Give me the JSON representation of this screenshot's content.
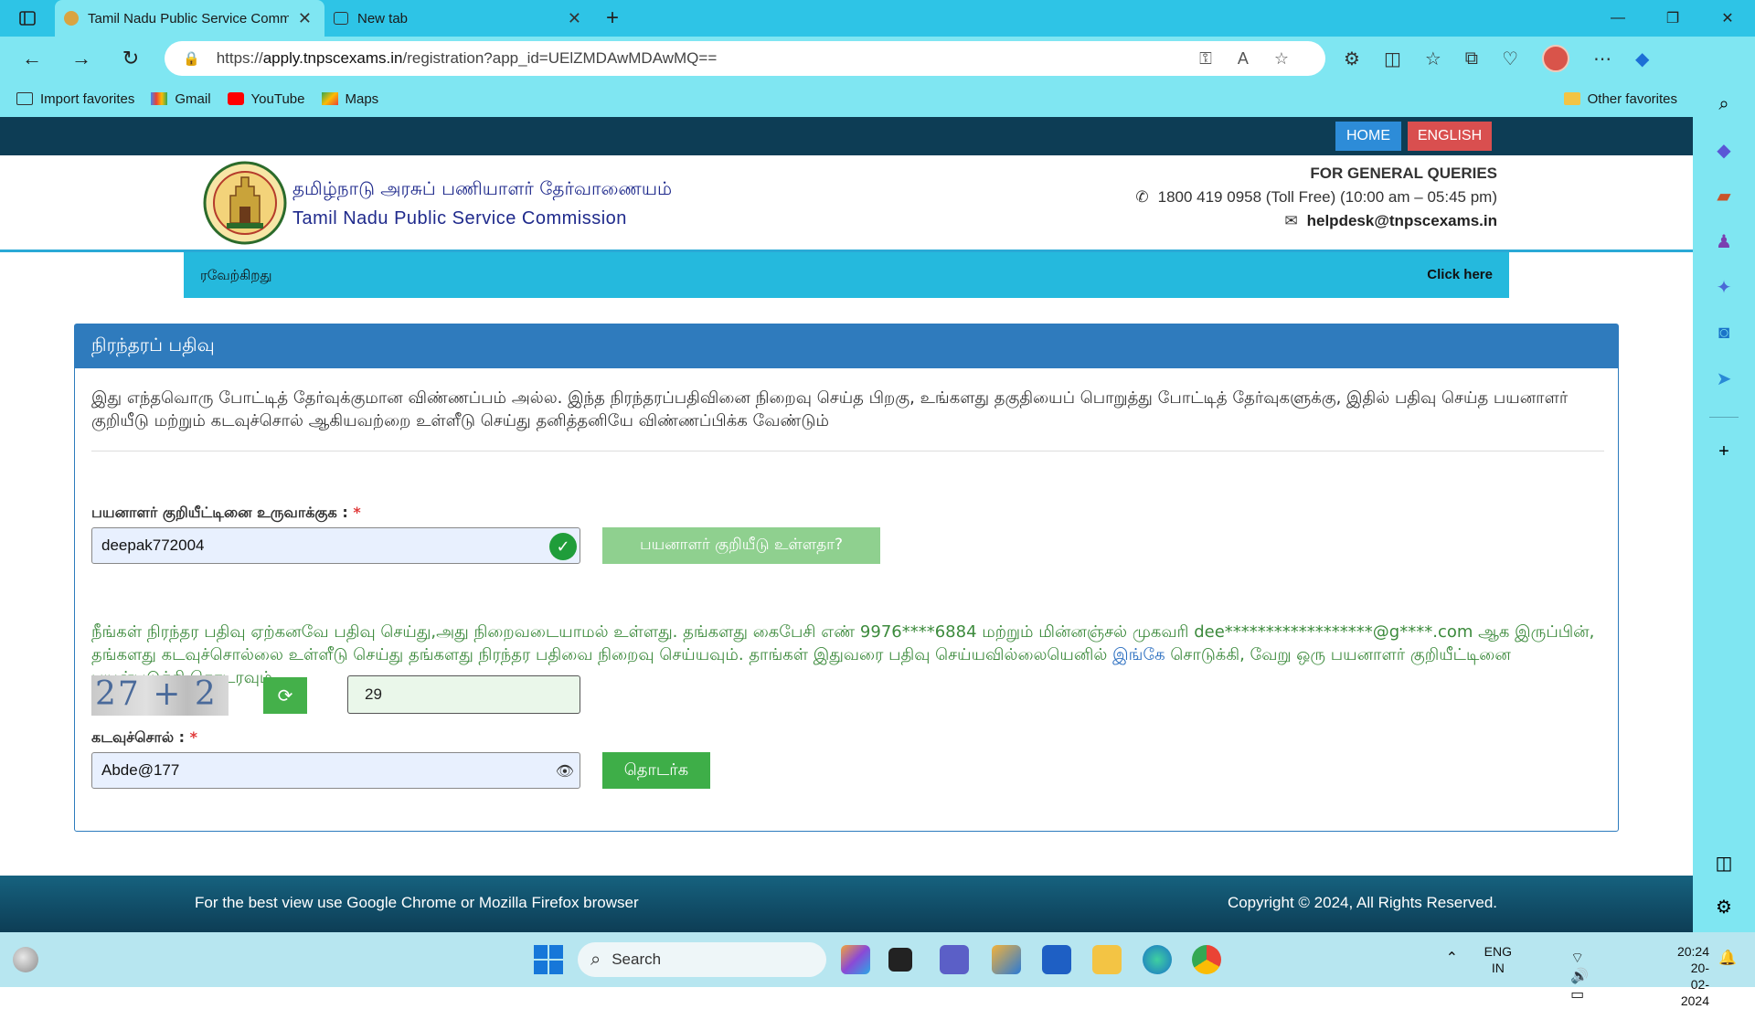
{
  "browser": {
    "tabs": [
      {
        "title": "Tamil Nadu Public Service Comm",
        "active": true
      },
      {
        "title": "New tab",
        "active": false
      }
    ],
    "url_prefix": "https://",
    "url_host": "apply.tnpscexams.in",
    "url_path": "/registration?app_id=UElZMDAwMDAwMQ==",
    "favorites": [
      {
        "label": "Import favorites",
        "icon": "import-icon"
      },
      {
        "label": "Gmail",
        "icon": "gmail-icon"
      },
      {
        "label": "YouTube",
        "icon": "youtube-icon"
      },
      {
        "label": "Maps",
        "icon": "maps-icon"
      }
    ],
    "other_favorites": "Other favorites"
  },
  "site": {
    "nav": {
      "home": "HOME",
      "english": "ENGLISH"
    },
    "org_name_ta": "தமிழ்நாடு அரசுப் பணியாளர் தேர்வாணையம்",
    "org_name_en": "Tamil Nadu Public Service Commission",
    "queries": {
      "title": "FOR GENERAL QUERIES",
      "phone": "1800 419 0958 (Toll Free)  (10:00 am – 05:45 pm)",
      "email": "helpdesk@tnpscexams.in"
    },
    "ticker": {
      "text": "ரவேற்கிறது",
      "link": "Click here"
    }
  },
  "form": {
    "heading": "நிரந்தரப் பதிவு",
    "intro": "இது எந்தவொரு போட்டித் தேர்வுக்குமான விண்ணப்பம் அல்ல. இந்த நிரந்தரப்பதிவினை நிறைவு செய்த பிறகு, உங்களது தகுதியைப் பொறுத்து போட்டித் தேர்வுகளுக்கு, இதில் பதிவு செய்த பயனாளர் குறியீடு மற்றும் கடவுச்சொல் ஆகியவற்றை உள்ளீடு செய்து தனித்தனியே விண்ணப்பிக்க வேண்டும்",
    "userid_label": "பயனாளர் குறியீட்டினை உருவாக்குக :",
    "required_mark": "*",
    "userid_value": "deepak772004",
    "check_button": "பயனாளர் குறியீடு உள்ளதா?",
    "info_text_1": "நீங்கள் நிரந்தர பதிவு ஏற்கனவே பதிவு செய்து,அது நிறைவடையாமல் உள்ளது. தங்களது கைபேசி எண் 9976****6884 மற்றும் மின்னஞ்சல் முகவரி dee******************@g****.com ஆக இருப்பின், தங்களது கடவுச்சொல்லை உள்ளீடு செய்து தங்களது நிரந்தர பதிவை நிறைவு செய்யவும். தாங்கள் இதுவரை பதிவு செய்யவில்லையெனில் ",
    "info_link": "இங்கே",
    "info_text_2": " சொடுக்கி, வேறு ஒரு பயனாளர் குறியீட்டினை பயன்படுத்தி தொடரவும்.",
    "captcha_text": "27 + 2 =",
    "captcha_answer": "29",
    "password_label": "கடவுச்சொல் :",
    "password_value": "Abde@177",
    "continue_button": "தொடர்க"
  },
  "footer": {
    "left": "For the best view use Google Chrome or Mozilla Firefox browser",
    "right": "Copyright © 2024, All Rights Reserved."
  },
  "taskbar": {
    "search_placeholder": "Search",
    "lang_top": "ENG",
    "lang_bottom": "IN",
    "time": "20:24",
    "date": "20-02-2024"
  },
  "colors": {
    "browser_accent": "#7fe6f2",
    "site_dark": "#0d3d55",
    "panel_blue": "#2f7bbd",
    "success_green": "#3eae48",
    "info_green": "#3c8a3c",
    "required_red": "#e03a3a"
  }
}
